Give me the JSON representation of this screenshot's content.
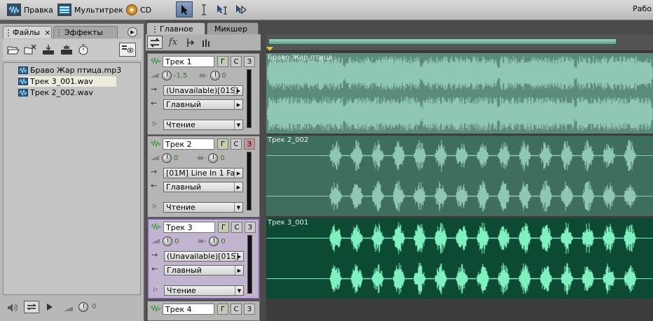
{
  "toolbar": {
    "edit_label": "Правка",
    "multitrack_label": "Мультитрек",
    "cd_label": "CD",
    "workspace_label": "Рабо"
  },
  "left_panel": {
    "tabs": [
      {
        "label": "Файлы"
      },
      {
        "label": "Эффекты"
      }
    ],
    "files": [
      {
        "name": "Браво Жар птица.mp3"
      },
      {
        "name": "Трек 3_001.wav"
      },
      {
        "name": "Трек 2_002.wav"
      }
    ],
    "volume_value": "0"
  },
  "main": {
    "tabs": [
      {
        "label": "Главное"
      },
      {
        "label": "Микшер"
      }
    ],
    "fx_label": "fx"
  },
  "tracks": [
    {
      "name": "Трек 1",
      "volume": "0",
      "pan": "-1.5",
      "input": "(Unavailable)[01S]",
      "output": "Главный",
      "automation": "Чтение",
      "m": "Г",
      "s": "С",
      "r": "З",
      "clip": "Браво Жар птица"
    },
    {
      "name": "Трек 2",
      "volume": "0",
      "pan": "0",
      "input": "[01M] Line In 1 Fa",
      "output": "Главный",
      "automation": "Чтение",
      "m": "Г",
      "s": "С",
      "r": "З",
      "clip": "Трек 2_002"
    },
    {
      "name": "Трек 3",
      "volume": "0",
      "pan": "0",
      "input": "(Unavailable)[01S]",
      "output": "Главный",
      "automation": "Чтение",
      "m": "Г",
      "s": "С",
      "r": "З",
      "clip": "Трек 3_001"
    },
    {
      "name": "Трек 4",
      "m": "Г",
      "s": "С",
      "r": "З"
    }
  ],
  "colors": {
    "wave_full": "#8fc7b2",
    "wave_sparse": "#8fc7b2",
    "clip_bg_1": "#5c8b7b",
    "clip_bg_2": "#3f6d5e",
    "clip_bg_3": "#0d4a33",
    "wave_bright": "#7ff0bf"
  }
}
